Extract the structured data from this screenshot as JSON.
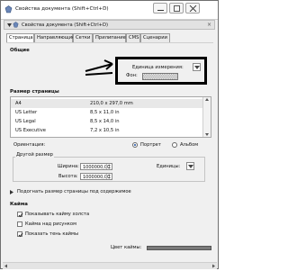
{
  "window": {
    "title": "Свойства документа (Shift+Ctrl+D)"
  },
  "dock": {
    "title": "Свойства документа (Shift+Ctrl+D)",
    "close_glyph": "×"
  },
  "tabs": [
    {
      "label": "Страница"
    },
    {
      "label": "Направляющие"
    },
    {
      "label": "Сетки"
    },
    {
      "label": "Прилипание"
    },
    {
      "label": "CMS"
    },
    {
      "label": "Сценарии"
    }
  ],
  "general": {
    "heading": "Общие",
    "units_label": "Единица измерения:",
    "background_label": "Фон:"
  },
  "page_size": {
    "heading": "Размер страницы",
    "rows": [
      {
        "name": "A4",
        "value": "210,0 x 297,0 mm",
        "selected": true
      },
      {
        "name": "US Letter",
        "value": "8,5 x 11,0 in"
      },
      {
        "name": "US Legal",
        "value": "8,5 x 14,0 in"
      },
      {
        "name": "US Executive",
        "value": "7,2 x 10,5 in"
      }
    ],
    "orientation_label": "Ориентация:",
    "portrait_label": "Портрет",
    "landscape_label": "Альбом",
    "custom_heading": "Другой размер",
    "width_label": "Ширина:",
    "width_value": "1000000,00",
    "height_label": "Высота:",
    "height_value": "1000000,00",
    "units_label": "Единицы:",
    "fit_label": "Подогнать размер страницы под содержимое"
  },
  "border": {
    "heading": "Кайма",
    "show_border": "Показывать кайму холста",
    "border_on_top": "Кайма над рисунком",
    "show_shadow": "Показать тень каймы",
    "border_color_label": "Цвет каймы:",
    "show_border_checked": true,
    "border_on_top_checked": false,
    "show_shadow_checked": true
  },
  "icons": {
    "app": "document-properties-icon",
    "minimize": "minimize-icon",
    "maximize": "maximize-icon",
    "close": "close-icon"
  }
}
